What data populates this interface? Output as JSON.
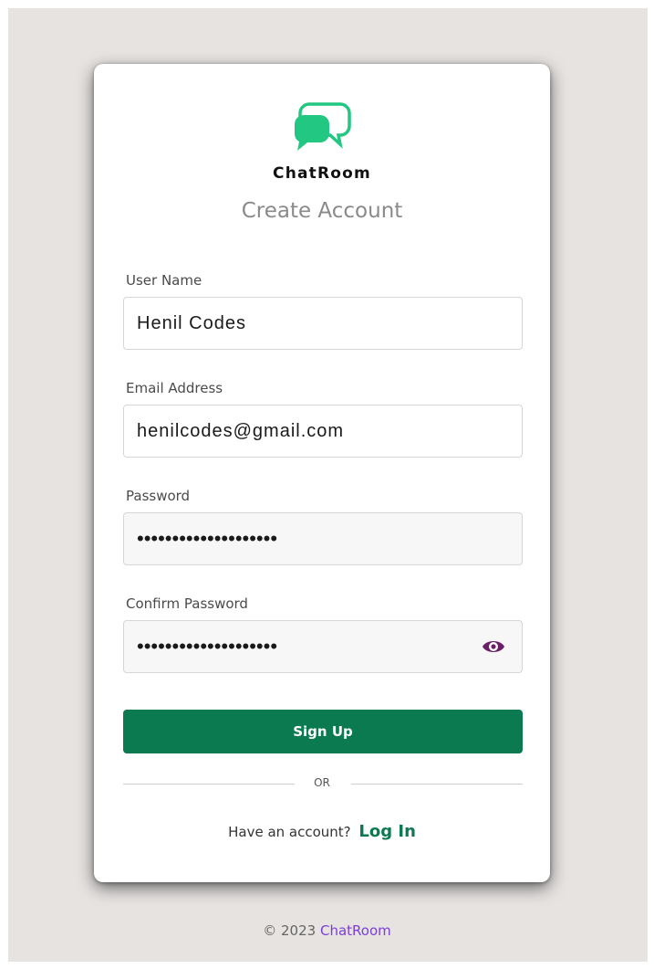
{
  "brand": {
    "name": "ChatRoom",
    "icon": "chat-bubbles-icon",
    "icon_color": "#22c781"
  },
  "title": "Create Account",
  "form": {
    "username": {
      "label": "User Name",
      "value": "Henil Codes"
    },
    "email": {
      "label": "Email Address",
      "value": "henilcodes@gmail.com"
    },
    "password": {
      "label": "Password",
      "value": "••••••••••••••••••••"
    },
    "confirm_password": {
      "label": "Confirm Password",
      "value": "••••••••••••••••••••",
      "toggle_icon": "eye-icon"
    },
    "submit_label": "Sign Up"
  },
  "divider_text": "OR",
  "login_prompt": {
    "text": "Have an account?",
    "link_label": "Log In"
  },
  "footer": {
    "copyright": "© 2023",
    "link_label": "ChatRoom"
  },
  "colors": {
    "background": "#e6e3e1",
    "primary": "#0c7a51",
    "accent_link": "#7b3fd6",
    "eye_icon": "#6a1f67"
  }
}
